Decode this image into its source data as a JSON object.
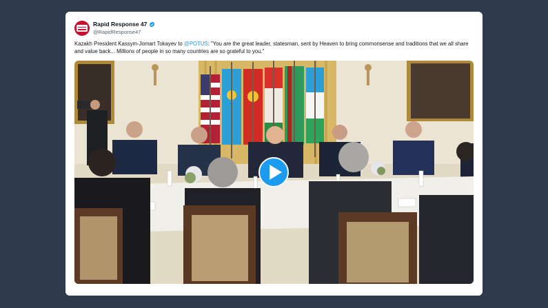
{
  "tweet": {
    "display_name": "Rapid Response 47",
    "handle": "@RapidResponse47",
    "verified_icon": "verified-badge-icon",
    "text_before": "Kazakh President Kassym-Jomart Tokayev to ",
    "mention": "@POTUS",
    "text_after": ": \"You are the great leader, statesman, sent by Heaven to bring commonsense and traditions that we all share and value back... Millions of people in so many countries are so grateful to you.\""
  },
  "video": {
    "play_icon": "play-icon"
  },
  "colors": {
    "page_bg": "#2f3a4d",
    "card_bg": "#ffffff",
    "accent": "#1d9bf0",
    "brand": "#c8102e"
  }
}
